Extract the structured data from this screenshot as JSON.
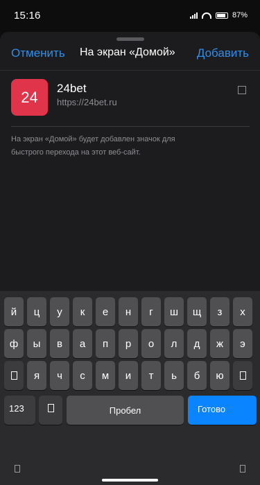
{
  "status_bar": {
    "time": "15:16",
    "battery": "87%"
  },
  "sheet": {
    "cancel_label": "Отменить",
    "title": "На экран «Домой»",
    "add_label": "Добавить"
  },
  "site": {
    "icon_text": "24",
    "icon_color": "#e0344a",
    "name": "24bet",
    "url": "https://24bet.ru",
    "clear_icon": "clear-text-icon"
  },
  "hint": "На экран «Домой» будет добавлен значок для быстрого перехода на этот веб-сайт.",
  "keyboard": {
    "rows": [
      [
        "й",
        "ц",
        "у",
        "к",
        "е",
        "н",
        "г",
        "ш",
        "щ",
        "з",
        "х"
      ],
      [
        "ф",
        "ы",
        "в",
        "а",
        "п",
        "р",
        "о",
        "л",
        "д",
        "ж",
        "э"
      ],
      [
        "я",
        "ч",
        "с",
        "м",
        "и",
        "т",
        "ь",
        "б",
        "ю"
      ]
    ],
    "numbers_label": "123",
    "space_label": "Пробел",
    "done_label": "Готово",
    "icons": [
      "shift-icon",
      "backspace-icon",
      "globe-icon",
      "emoji-icon",
      "dictation-icon"
    ],
    "accent_color": "#0a84ff"
  }
}
